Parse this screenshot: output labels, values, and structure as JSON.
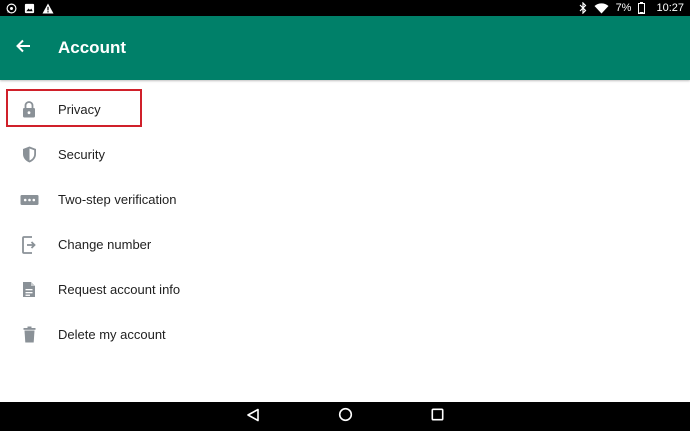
{
  "status_bar": {
    "battery": "7%",
    "time": "10:27",
    "left_icons": [
      "whatsapp-icon",
      "image-icon",
      "warning-icon"
    ],
    "right_icons": [
      "bluetooth-icon",
      "wifi-icon",
      "battery-icon"
    ]
  },
  "app_bar": {
    "title": "Account",
    "back_icon": "arrow-left-icon"
  },
  "menu": {
    "items": [
      {
        "label": "Privacy",
        "icon": "lock-icon",
        "highlighted": true
      },
      {
        "label": "Security",
        "icon": "shield-icon"
      },
      {
        "label": "Two-step verification",
        "icon": "dots-password-icon"
      },
      {
        "label": "Change number",
        "icon": "phone-change-icon"
      },
      {
        "label": "Request account info",
        "icon": "document-icon"
      },
      {
        "label": "Delete my account",
        "icon": "trash-icon"
      }
    ]
  },
  "nav_bar": {
    "buttons": [
      "back-triangle-icon",
      "home-circle-icon",
      "recents-square-icon"
    ]
  },
  "colors": {
    "app_bar": "#008069",
    "highlight": "#d0202a",
    "icon": "#8a9197"
  }
}
